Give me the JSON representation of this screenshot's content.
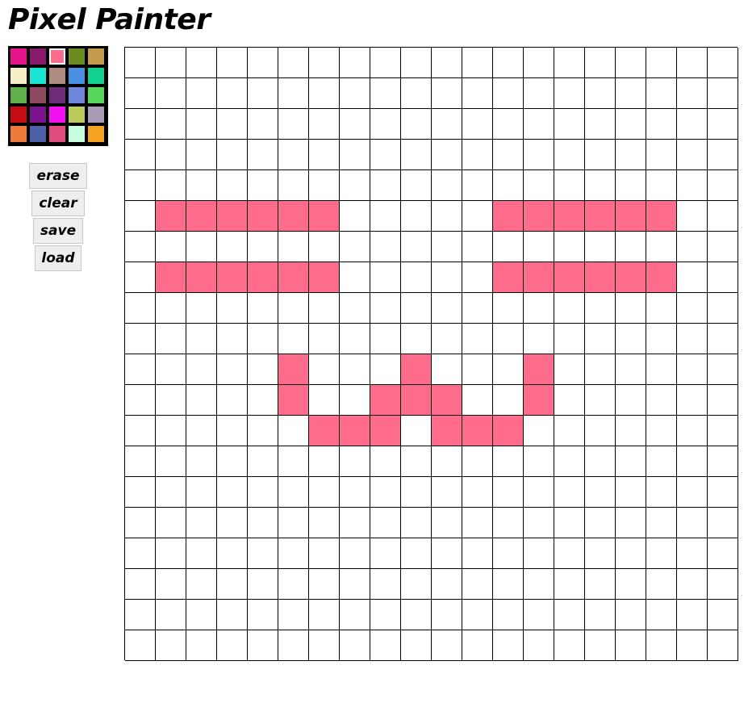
{
  "title": "Pixel Painter",
  "palette": {
    "selected_index": 2,
    "colors": [
      "#E8148C",
      "#8A1B6C",
      "#FF6B8A",
      "#6B8A1F",
      "#C49A4C",
      "#F4EFC4",
      "#18E6D2",
      "#B08C80",
      "#4A90E2",
      "#12D190",
      "#5FAF4A",
      "#8F4A62",
      "#6C2C78",
      "#6E86DC",
      "#57D65C",
      "#C80C14",
      "#7C1490",
      "#F010F0",
      "#BDCB5A",
      "#A89CB8",
      "#F07A3C",
      "#5060A8",
      "#E04C80",
      "#C8FFE2",
      "#F6A21E"
    ]
  },
  "buttons": {
    "erase": "erase",
    "clear": "clear",
    "save": "save",
    "load": "load"
  },
  "canvas": {
    "rows": 20,
    "cols": 20,
    "background": "#FFFFFF",
    "paint_color": "#FF6B8A",
    "painted_cells": [
      [
        5,
        1
      ],
      [
        5,
        2
      ],
      [
        5,
        3
      ],
      [
        5,
        4
      ],
      [
        5,
        5
      ],
      [
        5,
        6
      ],
      [
        5,
        12
      ],
      [
        5,
        13
      ],
      [
        5,
        14
      ],
      [
        5,
        15
      ],
      [
        5,
        16
      ],
      [
        5,
        17
      ],
      [
        7,
        1
      ],
      [
        7,
        2
      ],
      [
        7,
        3
      ],
      [
        7,
        4
      ],
      [
        7,
        5
      ],
      [
        7,
        6
      ],
      [
        7,
        12
      ],
      [
        7,
        13
      ],
      [
        7,
        14
      ],
      [
        7,
        15
      ],
      [
        7,
        16
      ],
      [
        7,
        17
      ],
      [
        10,
        5
      ],
      [
        10,
        9
      ],
      [
        10,
        13
      ],
      [
        11,
        5
      ],
      [
        11,
        8
      ],
      [
        11,
        9
      ],
      [
        11,
        10
      ],
      [
        11,
        13
      ],
      [
        12,
        6
      ],
      [
        12,
        7
      ],
      [
        12,
        8
      ],
      [
        12,
        10
      ],
      [
        12,
        11
      ],
      [
        12,
        12
      ]
    ]
  }
}
